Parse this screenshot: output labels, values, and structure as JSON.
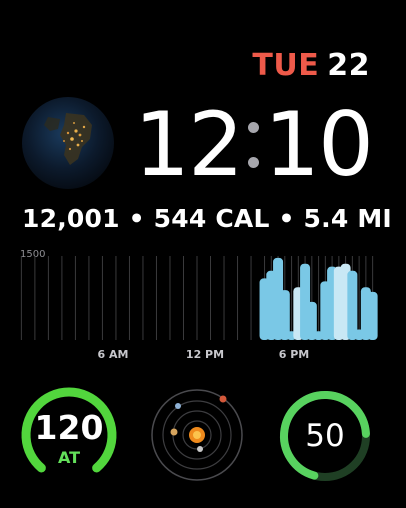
{
  "date": {
    "weekday": "TUE",
    "day": "22",
    "weekday_color": "#ee5a4a"
  },
  "time": {
    "hours": "12",
    "minutes": "10"
  },
  "activity": {
    "summary": "12,001 • 544 CAL • 5.4 MI"
  },
  "chart_data": {
    "type": "bar",
    "ylabel_tick": "1500",
    "x_ticks": [
      "6 AM",
      "12 PM",
      "6 PM"
    ],
    "values": [
      0,
      0,
      0,
      0,
      0,
      0,
      0,
      0,
      0,
      0,
      0,
      0,
      0,
      0,
      0,
      0,
      0,
      0,
      0,
      0,
      0,
      0,
      0,
      0,
      0,
      0,
      0,
      0,
      0,
      0,
      0,
      0,
      0,
      0,
      0,
      0,
      1050,
      1180,
      1400,
      850,
      150,
      900,
      1300,
      650,
      150,
      1000,
      1250,
      1250,
      1300,
      1180,
      180,
      900,
      820
    ],
    "ylim": [
      0,
      1500
    ],
    "bar_color": "#7ac8e6",
    "highlight_color": "#c9e8f5"
  },
  "complications": {
    "heart": {
      "value": "120",
      "label": "AT",
      "label_color": "#63e05a",
      "ring_color": "#52d63d"
    },
    "solar": {
      "icon": "solar-system-icon"
    },
    "ring50": {
      "value": "50",
      "progress": 0.7,
      "ring_color": "#58d25f",
      "track_color": "#1f3f24"
    }
  },
  "icons": {
    "earth": "earth-icon"
  }
}
